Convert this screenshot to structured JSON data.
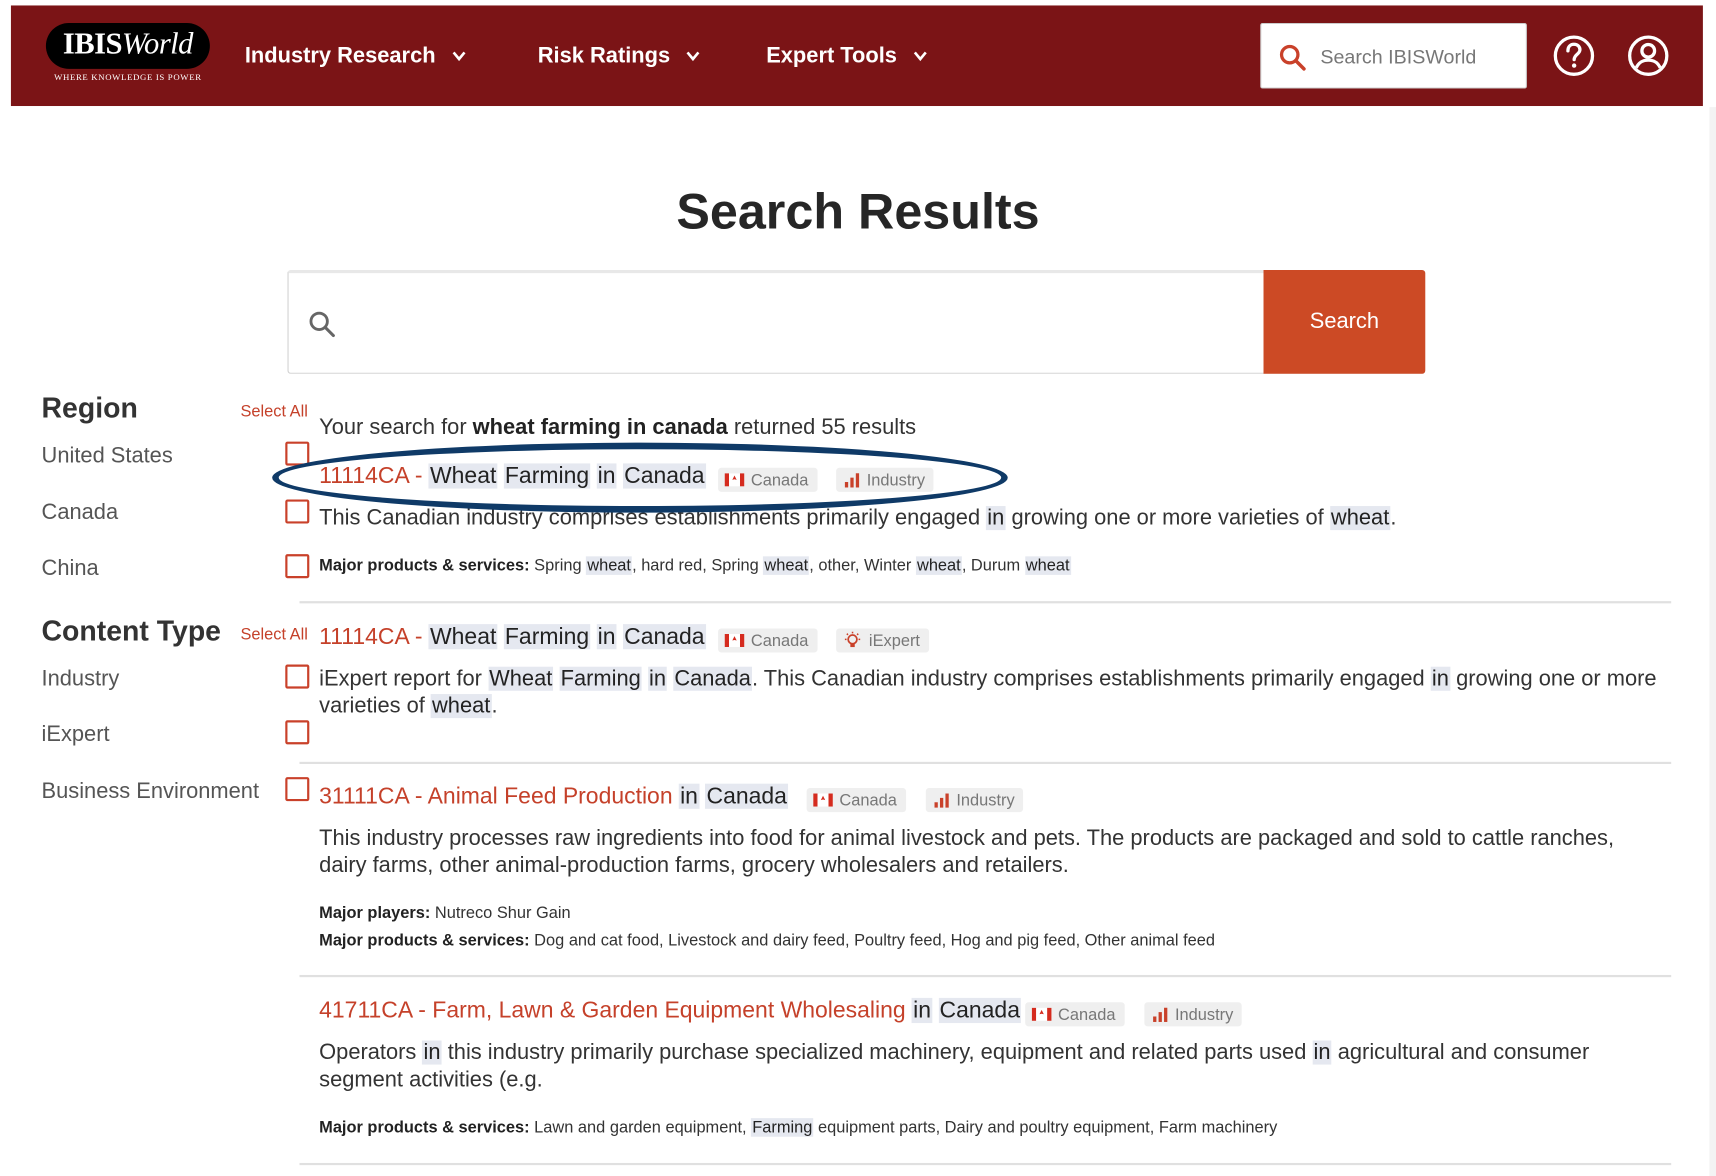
{
  "header": {
    "logo_text": "IBISWorld",
    "logo_tagline": "WHERE KNOWLEDGE IS POWER",
    "nav": [
      {
        "label": "Industry Research"
      },
      {
        "label": "Risk Ratings"
      },
      {
        "label": "Expert Tools"
      }
    ],
    "search_placeholder": "Search IBISWorld",
    "accent_color": "#7b1416"
  },
  "page_title": "Search Results",
  "main_search": {
    "value": "",
    "button_label": "Search",
    "button_color": "#cc4a25"
  },
  "filters": {
    "region": {
      "heading": "Region",
      "select_all": "Select All",
      "options": [
        "United States",
        "Canada",
        "China"
      ]
    },
    "content_type": {
      "heading": "Content Type",
      "select_all": "Select All",
      "options": [
        "Industry",
        "iExpert",
        "Business Environment"
      ]
    }
  },
  "results_summary": {
    "prefix": "Your search for ",
    "query": "wheat farming in canada",
    "suffix": " returned 55 results"
  },
  "results": [
    {
      "code": "11114CA -",
      "title_parts": [
        "Wheat",
        "Farming",
        "in",
        "Canada"
      ],
      "chip_country": "Canada",
      "chip_type": "Industry",
      "desc_1": "This Canadian industry comprises establishments primarily engaged ",
      "desc_hl_1": "in",
      "desc_2": " growing one or more varieties of ",
      "desc_hl_2": "wheat",
      "desc_3": ".",
      "products_label": "Major products & services:",
      "products": [
        " Spring ",
        "wheat",
        ", hard red, Spring ",
        "wheat",
        ", other, Winter ",
        "wheat",
        ", Durum ",
        "wheat"
      ]
    },
    {
      "code": "11114CA -",
      "title_parts": [
        "Wheat",
        "Farming",
        "in",
        "Canada"
      ],
      "chip_country": "Canada",
      "chip_type": "iExpert",
      "desc_a": "iExpert report for ",
      "desc_hl": [
        "Wheat",
        "Farming",
        "in",
        "Canada"
      ],
      "desc_b": ". This Canadian industry comprises establishments primarily engaged ",
      "desc_hl_in": "in",
      "desc_c": " growing one or more varieties of ",
      "desc_hl_wheat": "wheat",
      "desc_d": "."
    },
    {
      "code": "31111CA - Animal Feed Production",
      "title_hl": [
        "in",
        "Canada"
      ],
      "chip_country": "Canada",
      "chip_type": "Industry",
      "desc": "This industry processes raw ingredients into food for animal livestock and pets. The products are packaged and sold to cattle ranches, dairy farms, other animal-production farms, grocery wholesalers and retailers.",
      "players_label": "Major players:",
      "players": " Nutreco Shur Gain",
      "products_label": "Major products & services:",
      "products": " Dog and cat food, Livestock and dairy feed, Poultry feed, Hog and pig feed, Other animal feed"
    },
    {
      "code": "41711CA - Farm, Lawn & Garden Equipment Wholesaling",
      "title_hl": [
        "in",
        "Canada"
      ],
      "chip_country": "Canada",
      "chip_type": "Industry",
      "desc_a": "Operators ",
      "desc_hl_1": "in",
      "desc_b": " this industry primarily purchase specialized machinery, equipment and related parts used ",
      "desc_hl_2": "in",
      "desc_c": " agricultural and consumer segment activities (e.g.",
      "products_label": "Major products & services:",
      "products_a": " Lawn and garden equipment, ",
      "products_hl": "Farming",
      "products_b": " equipment parts, Dairy and poultry equipment, Farm machinery"
    }
  ]
}
